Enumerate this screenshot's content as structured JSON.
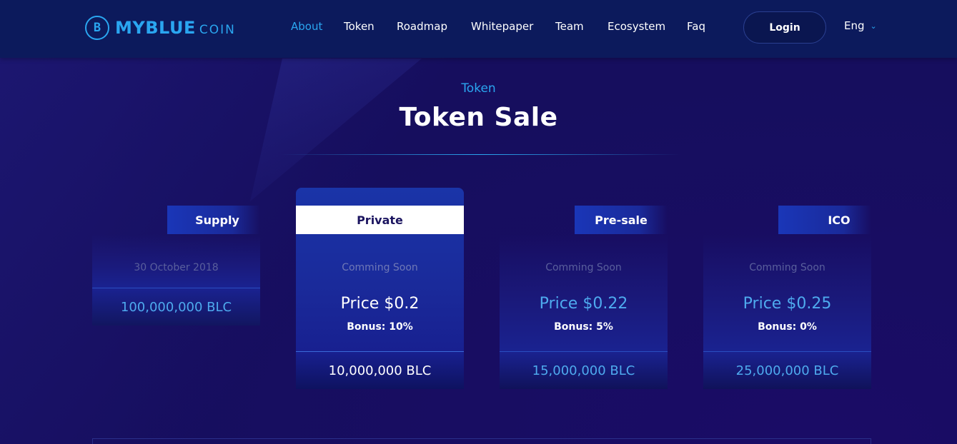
{
  "brand": {
    "mark": "B",
    "name": "MYBLUE",
    "suffix": "COIN"
  },
  "nav": {
    "items": [
      {
        "label": "About",
        "active": true
      },
      {
        "label": "Token"
      },
      {
        "label": "Roadmap"
      },
      {
        "label": "Whitepaper"
      },
      {
        "label": "Team"
      },
      {
        "label": "Ecosystem"
      },
      {
        "label": "Faq"
      }
    ],
    "login": "Login",
    "language": "Eng"
  },
  "section": {
    "subtitle": "Token",
    "title": "Token Sale"
  },
  "cards": [
    {
      "tag": "Supply",
      "date": "30 October 2018",
      "amount": "100,000,000 BLC"
    },
    {
      "tag": "Private",
      "status": "Comming Soon",
      "price": "Price $0.2",
      "bonus": "Bonus: 10%",
      "amount": "10,000,000 BLC"
    },
    {
      "tag": "Pre-sale",
      "status": "Comming Soon",
      "price": "Price $0.22",
      "bonus": "Bonus: 5%",
      "amount": "15,000,000 BLC"
    },
    {
      "tag": "ICO",
      "status": "Comming Soon",
      "price": "Price $0.25",
      "bonus": "Bonus: 0%",
      "amount": "25,000,000 BLC"
    }
  ],
  "colors": {
    "accent": "#2aa6f0",
    "background": "#160e5e",
    "header": "#0c1a5c"
  }
}
